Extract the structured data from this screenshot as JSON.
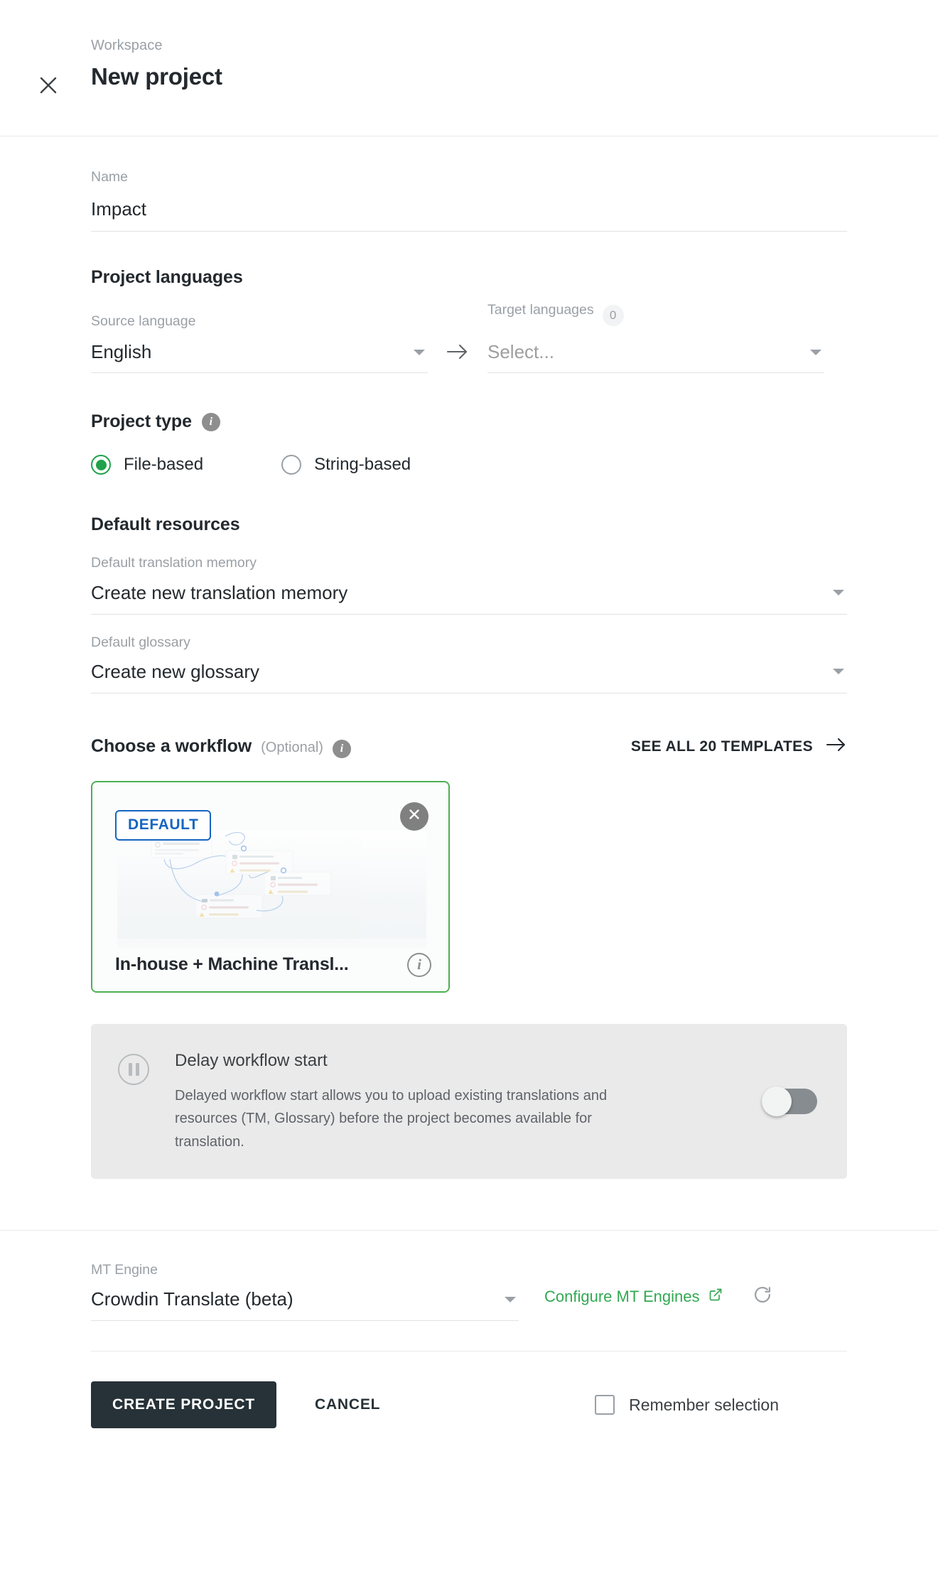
{
  "header": {
    "breadcrumb": "Workspace",
    "title": "New project",
    "close_icon": "close-icon"
  },
  "name_field": {
    "label": "Name",
    "value": "Impact"
  },
  "project_languages": {
    "section_title": "Project languages",
    "source": {
      "label": "Source language",
      "value": "English"
    },
    "arrow_icon": "arrow-right-icon",
    "target": {
      "label": "Target languages",
      "count": "0",
      "placeholder": "Select..."
    }
  },
  "project_type": {
    "section_title": "Project type",
    "info_icon": "info-icon",
    "options": [
      {
        "label": "File-based",
        "selected": true
      },
      {
        "label": "String-based",
        "selected": false
      }
    ]
  },
  "default_resources": {
    "section_title": "Default resources",
    "translation_memory": {
      "label": "Default translation memory",
      "value": "Create new translation memory"
    },
    "glossary": {
      "label": "Default glossary",
      "value": "Create new glossary"
    }
  },
  "workflow": {
    "section_title": "Choose a workflow",
    "optional": "(Optional)",
    "info_icon": "info-icon",
    "see_all_label": "SEE ALL 20 TEMPLATES",
    "see_all_icon": "arrow-right-icon",
    "card": {
      "badge": "DEFAULT",
      "title": "In-house + Machine Transl...",
      "close_icon": "close-circle-icon",
      "info_icon": "info-circle-icon"
    }
  },
  "delay": {
    "icon": "pause-icon",
    "title": "Delay workflow start",
    "description": "Delayed workflow start allows you to upload existing translations and resources (TM, Glossary) before the project becomes available for translation.",
    "toggle_on": false
  },
  "mt_engine": {
    "label": "MT Engine",
    "value": "Crowdin Translate (beta)",
    "configure_label": "Configure MT Engines",
    "external_icon": "external-link-icon",
    "refresh_icon": "refresh-icon"
  },
  "actions": {
    "create_label": "CREATE PROJECT",
    "cancel_label": "CANCEL",
    "remember_label": "Remember selection",
    "remember_checked": false
  },
  "colors": {
    "accent_green": "#20a14b",
    "link_green": "#32a852",
    "badge_blue": "#1565c0",
    "card_border": "#4caf50",
    "primary_button": "#263238"
  }
}
